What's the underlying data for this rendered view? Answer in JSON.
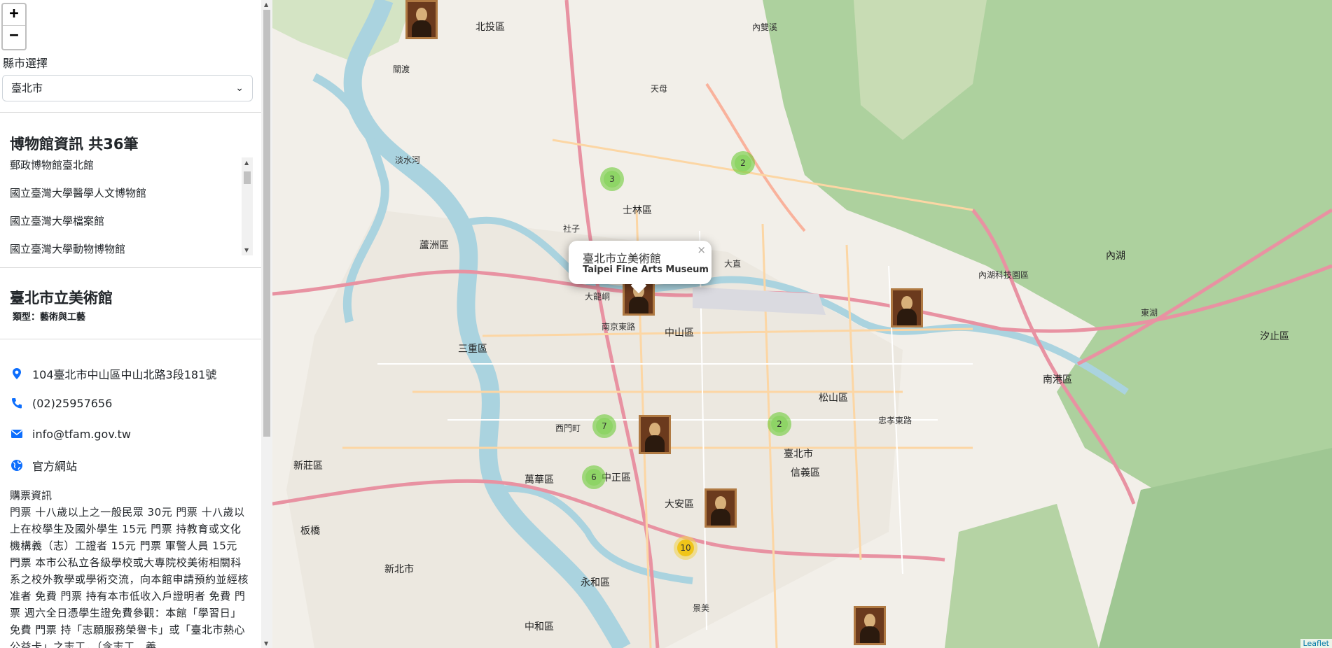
{
  "zoom": {
    "in_label": "+",
    "out_label": "−"
  },
  "county": {
    "label": "縣市選擇",
    "selected": "臺北市"
  },
  "museum_list": {
    "title": "博物館資訊 共36筆",
    "items": [
      "郵政博物館臺北館",
      "國立臺灣大學醫學人文博物館",
      "國立臺灣大學檔案館",
      "國立臺灣大學動物博物館"
    ]
  },
  "detail": {
    "name": "臺北市立美術館",
    "type": "類型：藝術與工藝",
    "address": "104臺北市中山區中山北路3段181號",
    "phone": "(02)25957656",
    "email": "info@tfam.gov.tw",
    "website": "官方網站",
    "ticket_title": "購票資訊",
    "ticket_text": "門票 十八歲以上之一般民眾 30元 門票 十八歲以上在校學生及國外學生 15元 門票 持教育或文化機構義（志）工證者 15元 門票 軍警人員 15元 門票 本市公私立各級學校或大專院校美術相關科系之校外教學或學術交流，向本館申請預約並經核准者 免費 門票 持有本市低收入戶證明者 免費 門票 週六全日憑學生證免費參觀：本館「學習日」 免費 門票 持「志願服務榮譽卡」或「臺北市熱心公益卡」之志工，（含志工、義"
  },
  "popup": {
    "name": "臺北市立美術館",
    "name_en": "Taipei Fine Arts Museum",
    "close": "×"
  },
  "clusters": [
    "3",
    "2",
    "7",
    "2",
    "6",
    "10"
  ],
  "places": [
    "北投區",
    "士林區",
    "內湖",
    "內湖科技園區",
    "大直",
    "大龍峒",
    "中山區",
    "松山區",
    "臺北市",
    "信義區",
    "萬華區",
    "大安區",
    "中正區",
    "三重區",
    "新北市",
    "南港區",
    "汐止區",
    "東湖",
    "永和區",
    "中和區",
    "景美",
    "板橋",
    "蘆洲區",
    "新莊區",
    "淡水河",
    "關渡",
    "天母",
    "內雙溪",
    "社子",
    "西門町",
    "南京東路",
    "忠孝東路"
  ],
  "attribution": "Leaflet",
  "colors": {
    "park": "#add19e",
    "forest": "#c8dcb4",
    "motorway": "#e892a2",
    "river": "#aad3df",
    "cluster_green": "#8cd464",
    "cluster_yellow": "#f0c20c"
  }
}
